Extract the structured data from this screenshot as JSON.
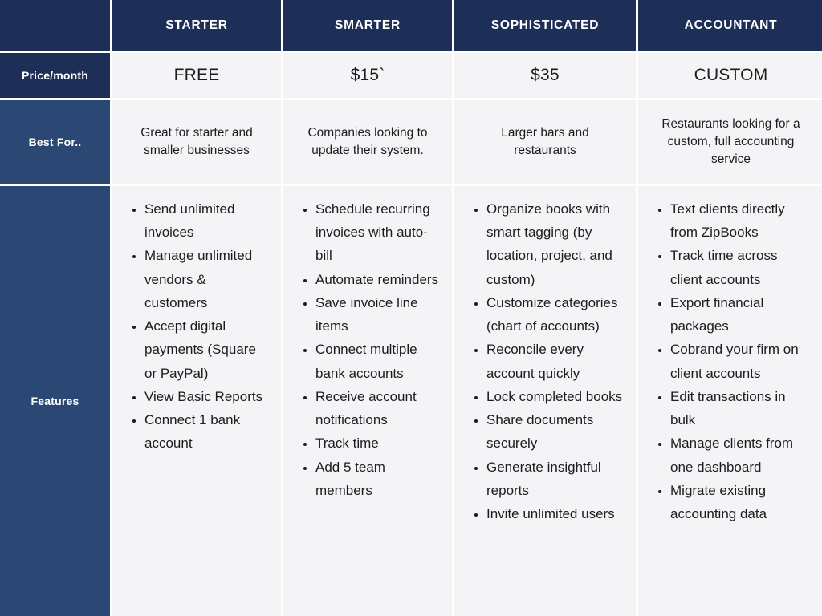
{
  "theme": {
    "header_navy": "#1e2f57",
    "label_navy": "#2a4873",
    "cell_background": "#f4f3f5",
    "page_background": "#ffffff",
    "text_color": "#1d1d1f",
    "header_text_color": "#ffffff"
  },
  "table": {
    "row_labels": {
      "corner": "",
      "price": "Price/month",
      "best_for": "Best For..",
      "features": "Features"
    },
    "plans": [
      {
        "name": "STARTER",
        "price": "FREE",
        "best_for": "Great for starter and smaller businesses",
        "features": [
          "Send unlimited invoices",
          "Manage unlimited vendors & customers",
          "Accept digital payments (Square or PayPal)",
          "View Basic Reports",
          "Connect 1 bank account"
        ]
      },
      {
        "name": "SMARTER",
        "price": "$15`",
        "best_for": "Companies looking to update their system.",
        "features": [
          "Schedule recurring invoices with auto-bill",
          "Automate reminders",
          "Save invoice line items",
          "Connect multiple bank accounts",
          "Receive account notifications",
          "Track time",
          "Add 5 team members"
        ]
      },
      {
        "name": "SOPHISTICATED",
        "price": "$35",
        "best_for": "Larger bars and restaurants",
        "features": [
          "Organize books with smart tagging (by location, project, and custom)",
          "Customize categories (chart of accounts)",
          "Reconcile every account quickly",
          "Lock completed books",
          "Share documents securely",
          "Generate insightful reports",
          "Invite unlimited users"
        ]
      },
      {
        "name": "ACCOUNTANT",
        "price": "CUSTOM",
        "best_for": "Restaurants looking for a custom, full accounting service",
        "features": [
          "Text clients directly from ZipBooks",
          "Track time across client accounts",
          "Export financial packages",
          "Cobrand your firm on client accounts",
          "Edit transactions in bulk",
          "Manage clients from one dashboard",
          "Migrate existing accounting data"
        ]
      }
    ]
  }
}
